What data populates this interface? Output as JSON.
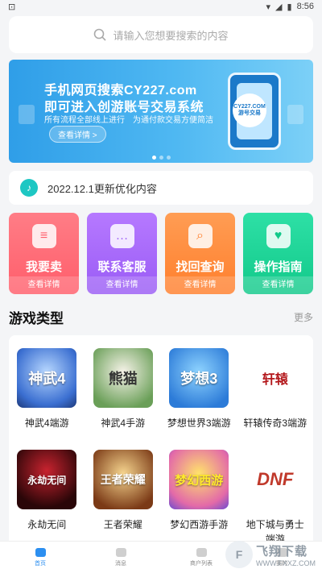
{
  "status_bar": {
    "time": "8:56"
  },
  "search": {
    "placeholder": "请输入您想要搜索的内容"
  },
  "banner": {
    "line1": "手机网页搜索CY227.com",
    "line2": "即可进入创游账号交易系统",
    "line3": "所有流程全部线上进行　为通付款交易方便简洁",
    "button": "查看详情 >",
    "badge": "CY227.COM 游号交易"
  },
  "notice": {
    "text": "2022.12.1更新优化内容"
  },
  "quick_cards": [
    {
      "title": "我要卖",
      "sub": "查看详情",
      "icon": "≡"
    },
    {
      "title": "联系客服",
      "sub": "查看详情",
      "icon": "…"
    },
    {
      "title": "找回查询",
      "sub": "查看详情",
      "icon": "⌕"
    },
    {
      "title": "操作指南",
      "sub": "查看详情",
      "icon": "♥"
    }
  ],
  "games_section": {
    "title": "游戏类型",
    "more": "更多"
  },
  "games": [
    {
      "name": "神武4端游",
      "thumb_text": "神武4"
    },
    {
      "name": "神武4手游",
      "thumb_text": "熊猫"
    },
    {
      "name": "梦想世界3端游",
      "thumb_text": "梦想3"
    },
    {
      "name": "轩辕传奇3端游",
      "thumb_text": "轩辕"
    },
    {
      "name": "永劫无间",
      "thumb_text": "永劫无间"
    },
    {
      "name": "王者荣耀",
      "thumb_text": "王者荣耀"
    },
    {
      "name": "梦幻西游手游",
      "thumb_text": "梦幻西游"
    },
    {
      "name": "地下城与勇士端游",
      "thumb_text": "DNF"
    }
  ],
  "tabbar": [
    {
      "label": "首页",
      "active": true
    },
    {
      "label": "消息",
      "active": false
    },
    {
      "label": "商户列表",
      "active": false
    },
    {
      "label": "我的",
      "active": false
    }
  ],
  "watermark": {
    "title": "飞翔下载",
    "url": "WWW.FXXZ.COM"
  }
}
